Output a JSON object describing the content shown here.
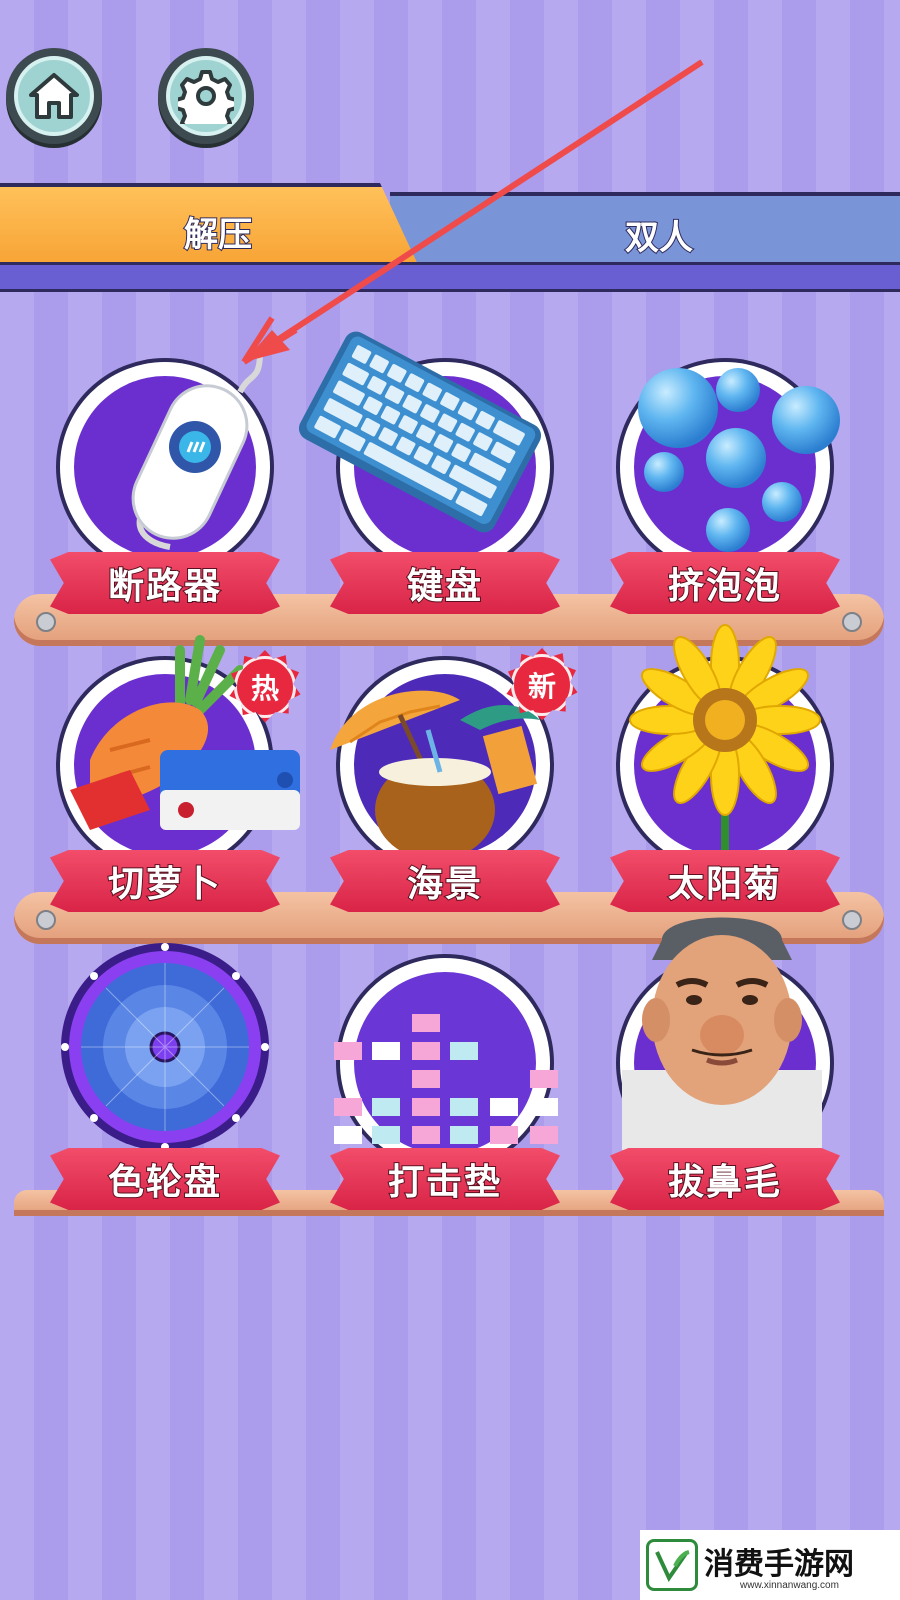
{
  "header": {
    "home_icon": "home-icon",
    "settings_icon": "gear-icon"
  },
  "tabs": [
    {
      "label": "解压",
      "active": true
    },
    {
      "label": "双人",
      "active": false
    }
  ],
  "games": [
    {
      "label": "断路器",
      "icon": "circuit-breaker-icon",
      "badge": ""
    },
    {
      "label": "键盘",
      "icon": "keyboard-icon",
      "badge": ""
    },
    {
      "label": "挤泡泡",
      "icon": "bubbles-icon",
      "badge": ""
    },
    {
      "label": "切萝卜",
      "icon": "carrot-icon",
      "badge": "热"
    },
    {
      "label": "海景",
      "icon": "coconut-beach-icon",
      "badge": "新"
    },
    {
      "label": "太阳菊",
      "icon": "sunflower-icon",
      "badge": ""
    },
    {
      "label": "色轮盘",
      "icon": "color-wheel-icon",
      "badge": ""
    },
    {
      "label": "打击垫",
      "icon": "drum-pad-icon",
      "badge": ""
    },
    {
      "label": "拔鼻毛",
      "icon": "face-icon",
      "badge": ""
    }
  ],
  "watermark": {
    "text": "消费手游网",
    "url": "www.xinnanwang.com"
  },
  "colors": {
    "accent_tab": "#f7a233",
    "ribbon": "#d92447",
    "annotation_arrow": "#ef4b4b"
  }
}
